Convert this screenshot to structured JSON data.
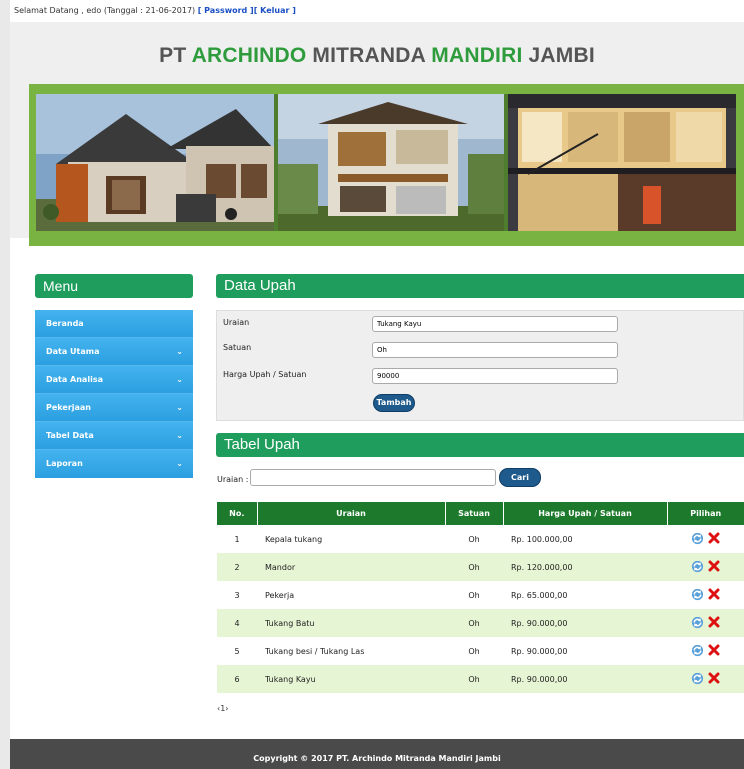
{
  "topbar": {
    "welcome": "Selamat Datang , edo (Tanggal : 21-06-2017)",
    "password_link": "[ Password ]",
    "logout_link": "[ Keluar ]"
  },
  "header": {
    "title_pt": "PT ",
    "title_archindo": "ARCHINDO",
    "title_mitranda": " MITRANDA ",
    "title_mandiri": "MANDIRI",
    "title_jambi": " JAMBI"
  },
  "menu": {
    "title": "Menu",
    "items": [
      {
        "label": "Beranda",
        "dropdown": false
      },
      {
        "label": "Data Utama",
        "dropdown": true
      },
      {
        "label": "Data Analisa",
        "dropdown": true
      },
      {
        "label": "Pekerjaan",
        "dropdown": true
      },
      {
        "label": "Tabel Data",
        "dropdown": true
      },
      {
        "label": "Laporan",
        "dropdown": true
      }
    ]
  },
  "form": {
    "title": "Data Upah",
    "uraian_label": "Uraian",
    "uraian_value": "Tukang Kayu",
    "satuan_label": "Satuan",
    "satuan_value": "Oh",
    "harga_label": "Harga Upah / Satuan",
    "harga_value": "90000",
    "submit_label": "Tambah"
  },
  "table_section": {
    "title": "Tabel Upah",
    "search_label": "Uraian :",
    "search_value": "",
    "search_button": "Cari",
    "columns": [
      "No.",
      "Uraian",
      "Satuan",
      "Harga Upah / Satuan",
      "Pilihan"
    ],
    "rows": [
      {
        "no": "1",
        "uraian": "Kepala tukang",
        "satuan": "Oh",
        "harga": "Rp. 100.000,00"
      },
      {
        "no": "2",
        "uraian": "Mandor",
        "satuan": "Oh",
        "harga": "Rp. 120.000,00"
      },
      {
        "no": "3",
        "uraian": "Pekerja",
        "satuan": "Oh",
        "harga": "Rp. 65.000,00"
      },
      {
        "no": "4",
        "uraian": "Tukang Batu",
        "satuan": "Oh",
        "harga": "Rp. 90.000,00"
      },
      {
        "no": "5",
        "uraian": "Tukang besi / Tukang Las",
        "satuan": "Oh",
        "harga": "Rp. 90.000,00"
      },
      {
        "no": "6",
        "uraian": "Tukang Kayu",
        "satuan": "Oh",
        "harga": "Rp. 90.000,00"
      }
    ],
    "pager": "‹1›"
  },
  "footer": {
    "copyright": "Copyright © 2017 PT. Archindo Mitranda Mandiri Jambi"
  },
  "icons": {
    "edit": "refresh-icon",
    "delete": "close-icon",
    "dropdown": "chevron-down-icon"
  },
  "colors": {
    "brand_green": "#1f9d5c",
    "menu_blue": "#2fa6e6",
    "table_header": "#1d7a2c",
    "row_alt": "#e6f5d4",
    "button_blue": "#1e5a8c"
  }
}
